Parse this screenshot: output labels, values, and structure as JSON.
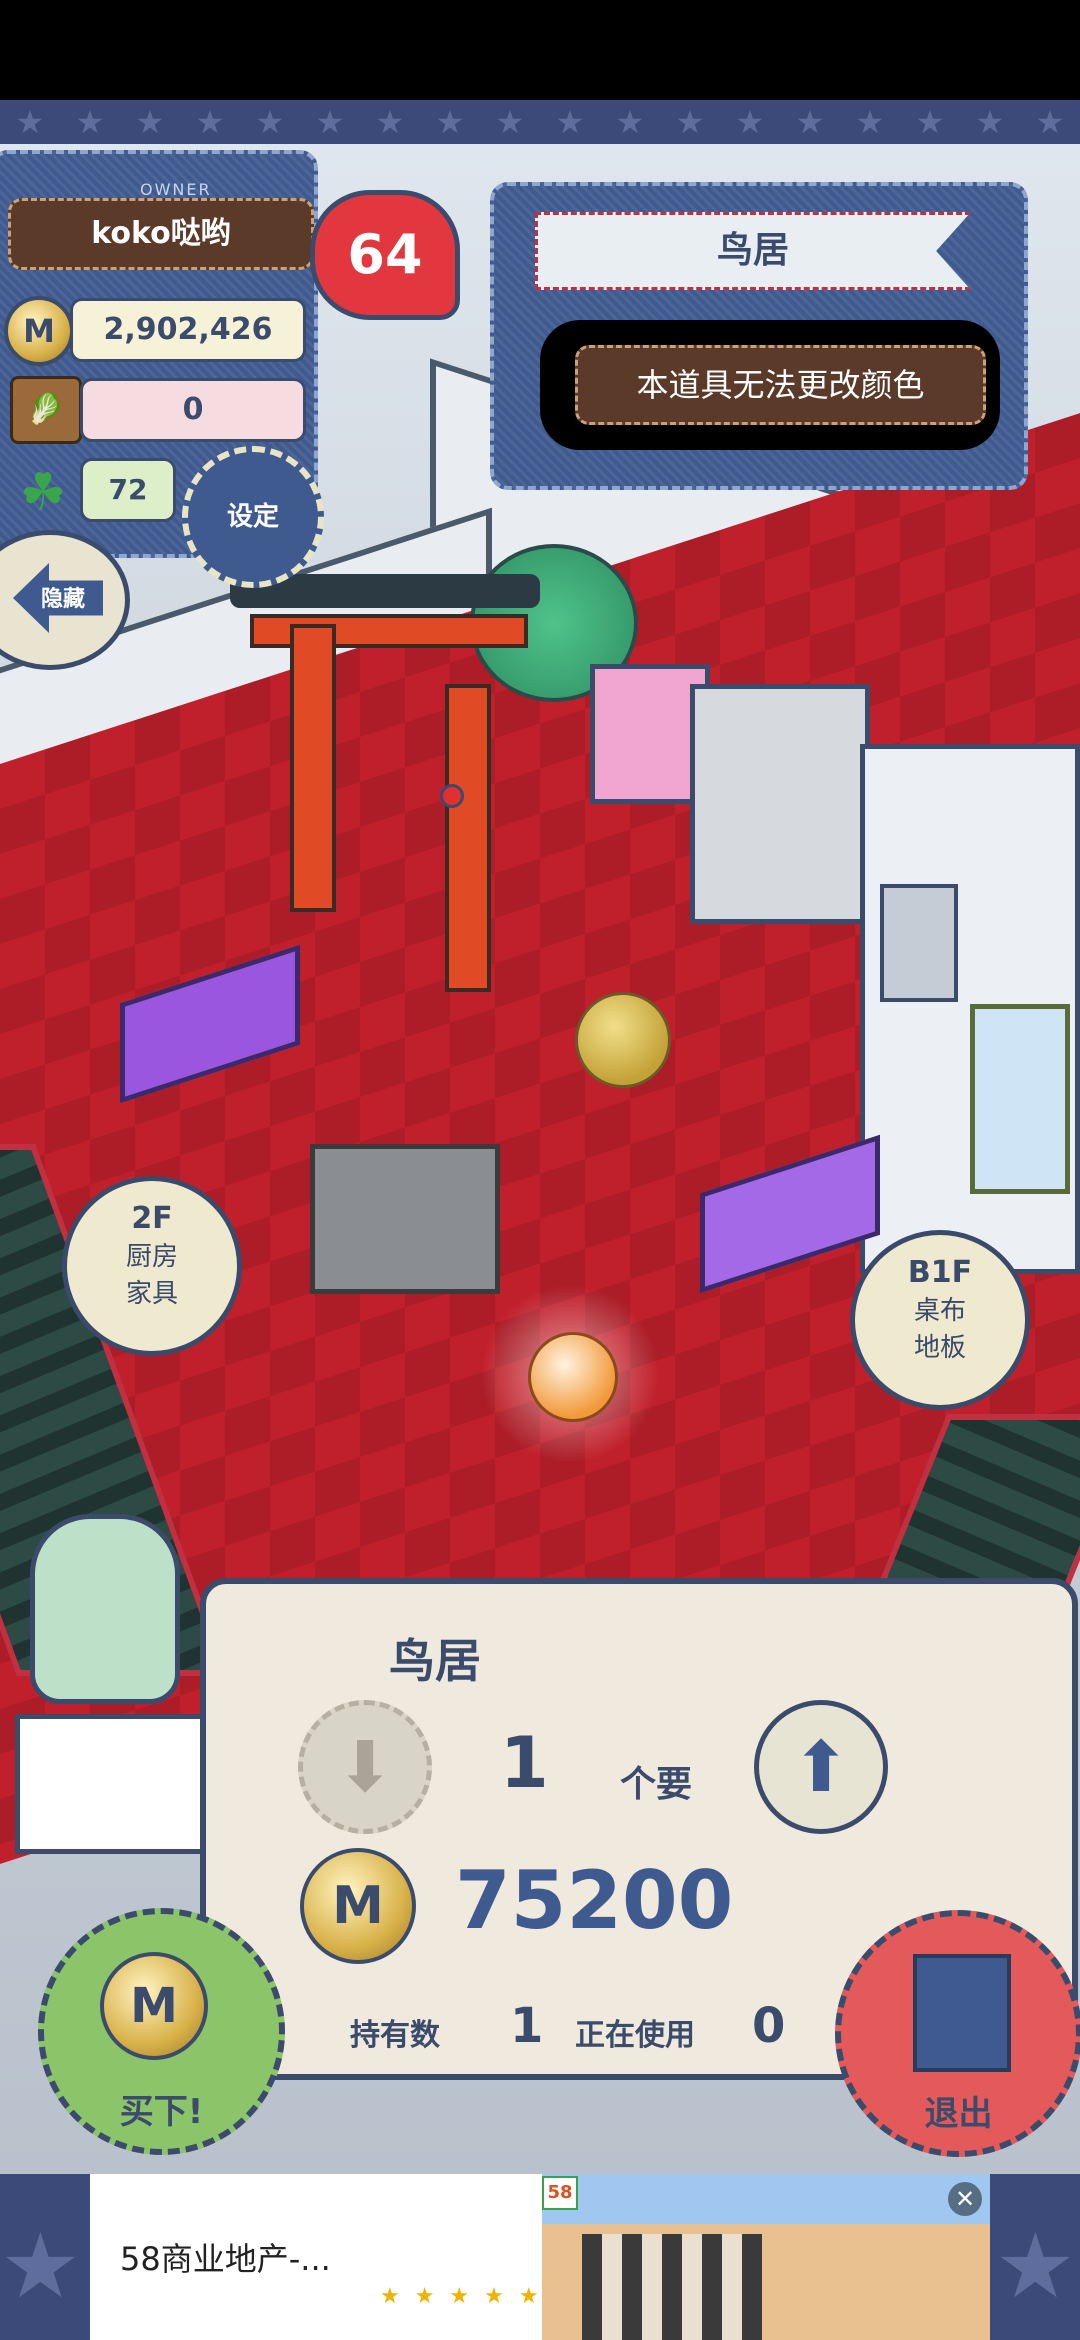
{
  "hud": {
    "owner_tag": "OWNER",
    "owner_name": "koko哒哟",
    "level": "64",
    "money": "2,902,426",
    "basket_count": "0",
    "clover_count": "72",
    "settings_label": "设定",
    "hide_label": "隐藏"
  },
  "item_info": {
    "name": "鸟居",
    "notice": "本道具无法更改颜色"
  },
  "floors": {
    "up": {
      "floor": "2F",
      "line1": "厨房",
      "line2": "家具"
    },
    "down": {
      "floor": "B1F",
      "line1": "桌布",
      "line2": "地板"
    }
  },
  "purchase": {
    "item_name": "鸟居",
    "quantity": "1",
    "quantity_unit": "个要",
    "price": "75200",
    "owned_label": "持有数",
    "owned_value": "1",
    "in_use_label": "正在使用",
    "in_use_value": "0",
    "buy_label": "买下!",
    "exit_label": "退出"
  },
  "ad": {
    "badge": "58",
    "title": "58商业地产-...",
    "stars": "★ ★ ★ ★ ★"
  },
  "icons": {
    "coin": "M"
  },
  "colors": {
    "floor_red": "#c0202b",
    "denim": "#3f5a8f",
    "panel_border": "#3b4b6b",
    "buy_green": "#8cc46a",
    "exit_red": "#e45a5a"
  }
}
